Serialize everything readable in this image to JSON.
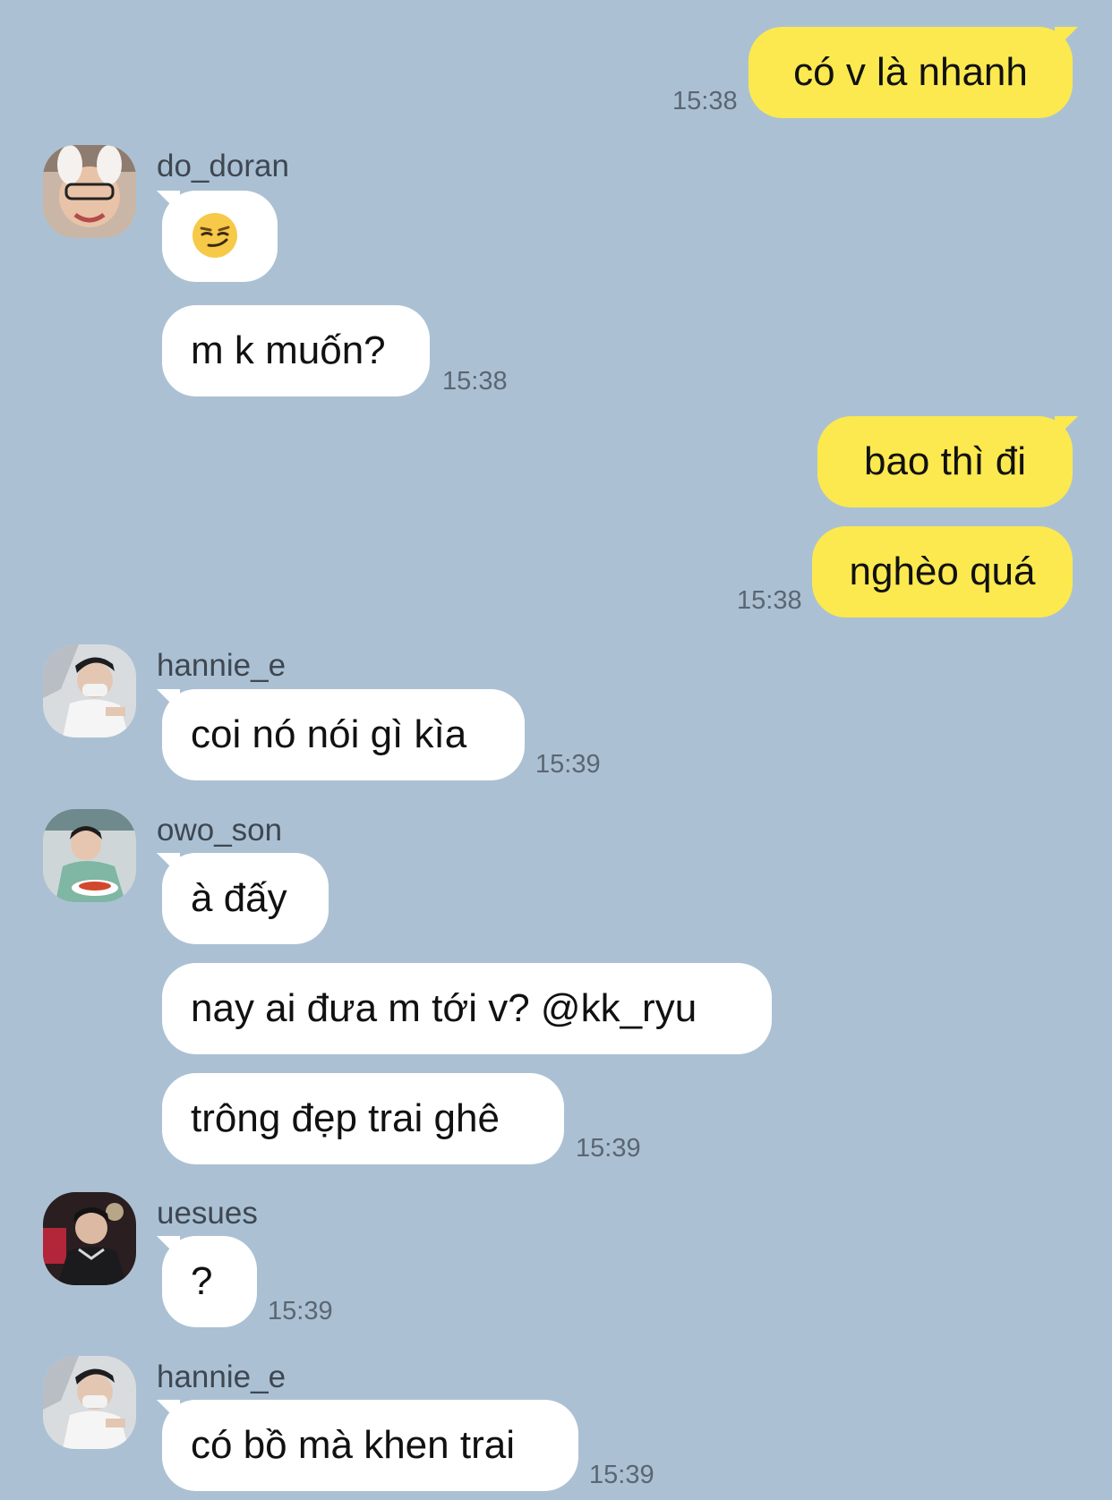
{
  "messages": [
    {
      "text": "có v là nhanh",
      "time": "15:38"
    },
    {
      "sender": "do_doran",
      "text": "",
      "emoji": "smirking-face-icon"
    },
    {
      "text": "m k muốn?",
      "time": "15:38"
    },
    {
      "text": "bao thì đi"
    },
    {
      "text": "nghèo quá",
      "time": "15:38"
    },
    {
      "sender": "hannie_e",
      "text": "coi nó nói gì kìa",
      "time": "15:39"
    },
    {
      "sender": "owo_son",
      "text": "à đấy"
    },
    {
      "text": "nay ai đưa m tới v? @kk_ryu"
    },
    {
      "text": "trông đẹp trai ghê",
      "time": "15:39"
    },
    {
      "sender": "uesues",
      "text": "?",
      "time": "15:39"
    },
    {
      "sender": "hannie_e",
      "text": "có bồ mà khen trai",
      "time": "15:39"
    }
  ],
  "colors": {
    "background": "#abc1d3",
    "outgoing_bubble": "#fbe94f",
    "incoming_bubble": "#ffffff",
    "timestamp": "#5b6673",
    "sender_name": "#3e4752"
  }
}
